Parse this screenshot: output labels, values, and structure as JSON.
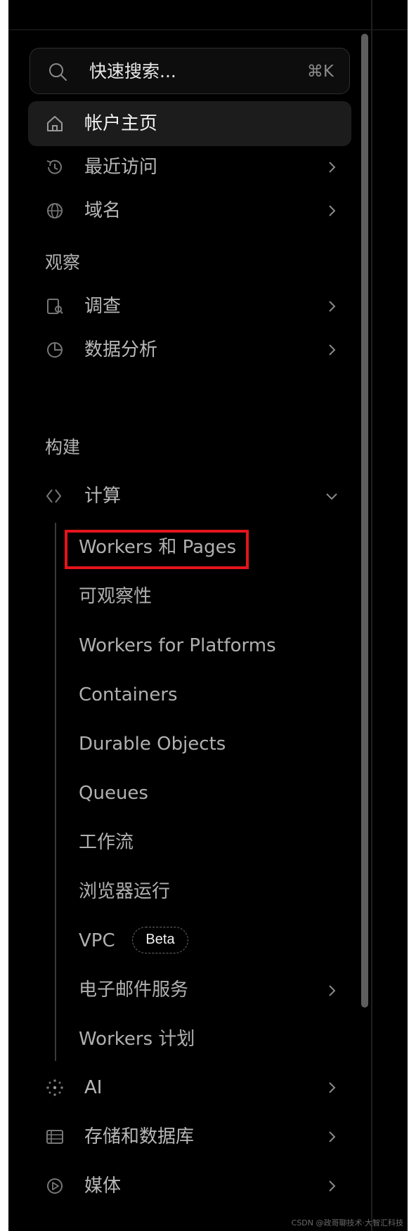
{
  "search": {
    "placeholder": "快速搜索...",
    "shortcut": "⌘K",
    "icon": "search-icon"
  },
  "nav": {
    "home": {
      "label": "帐户主页",
      "icon": "home-icon"
    },
    "recent": {
      "label": "最近访问",
      "icon": "history-icon"
    },
    "domains": {
      "label": "域名",
      "icon": "globe-icon"
    }
  },
  "sections": {
    "observe": {
      "title": "观察",
      "items": [
        {
          "label": "调查",
          "icon": "investigate-icon"
        },
        {
          "label": "数据分析",
          "icon": "pie-chart-icon"
        }
      ]
    },
    "build": {
      "title": "构建",
      "compute": {
        "label": "计算",
        "icon": "code-brackets-icon",
        "expanded": true
      },
      "compute_children": [
        "Workers 和 Pages",
        "可观察性",
        "Workers for Platforms",
        "Containers",
        "Durable Objects",
        "Queues",
        "工作流",
        "浏览器运行",
        "VPC",
        "电子邮件服务",
        "Workers 计划"
      ],
      "vpc_badge": "Beta",
      "ai": {
        "label": "AI",
        "icon": "sparkle-icon"
      },
      "storage": {
        "label": "存储和数据库",
        "icon": "database-icon"
      },
      "media": {
        "label": "媒体",
        "icon": "play-circle-icon"
      }
    }
  },
  "highlighted_item": "Workers 和 Pages",
  "colors": {
    "background": "#000000",
    "active_bg": "#1c1c1c",
    "highlight": "#e3141b",
    "text": "#b8b8b8"
  },
  "watermark": "CSDN @政哥聊技术·大智汇科技"
}
